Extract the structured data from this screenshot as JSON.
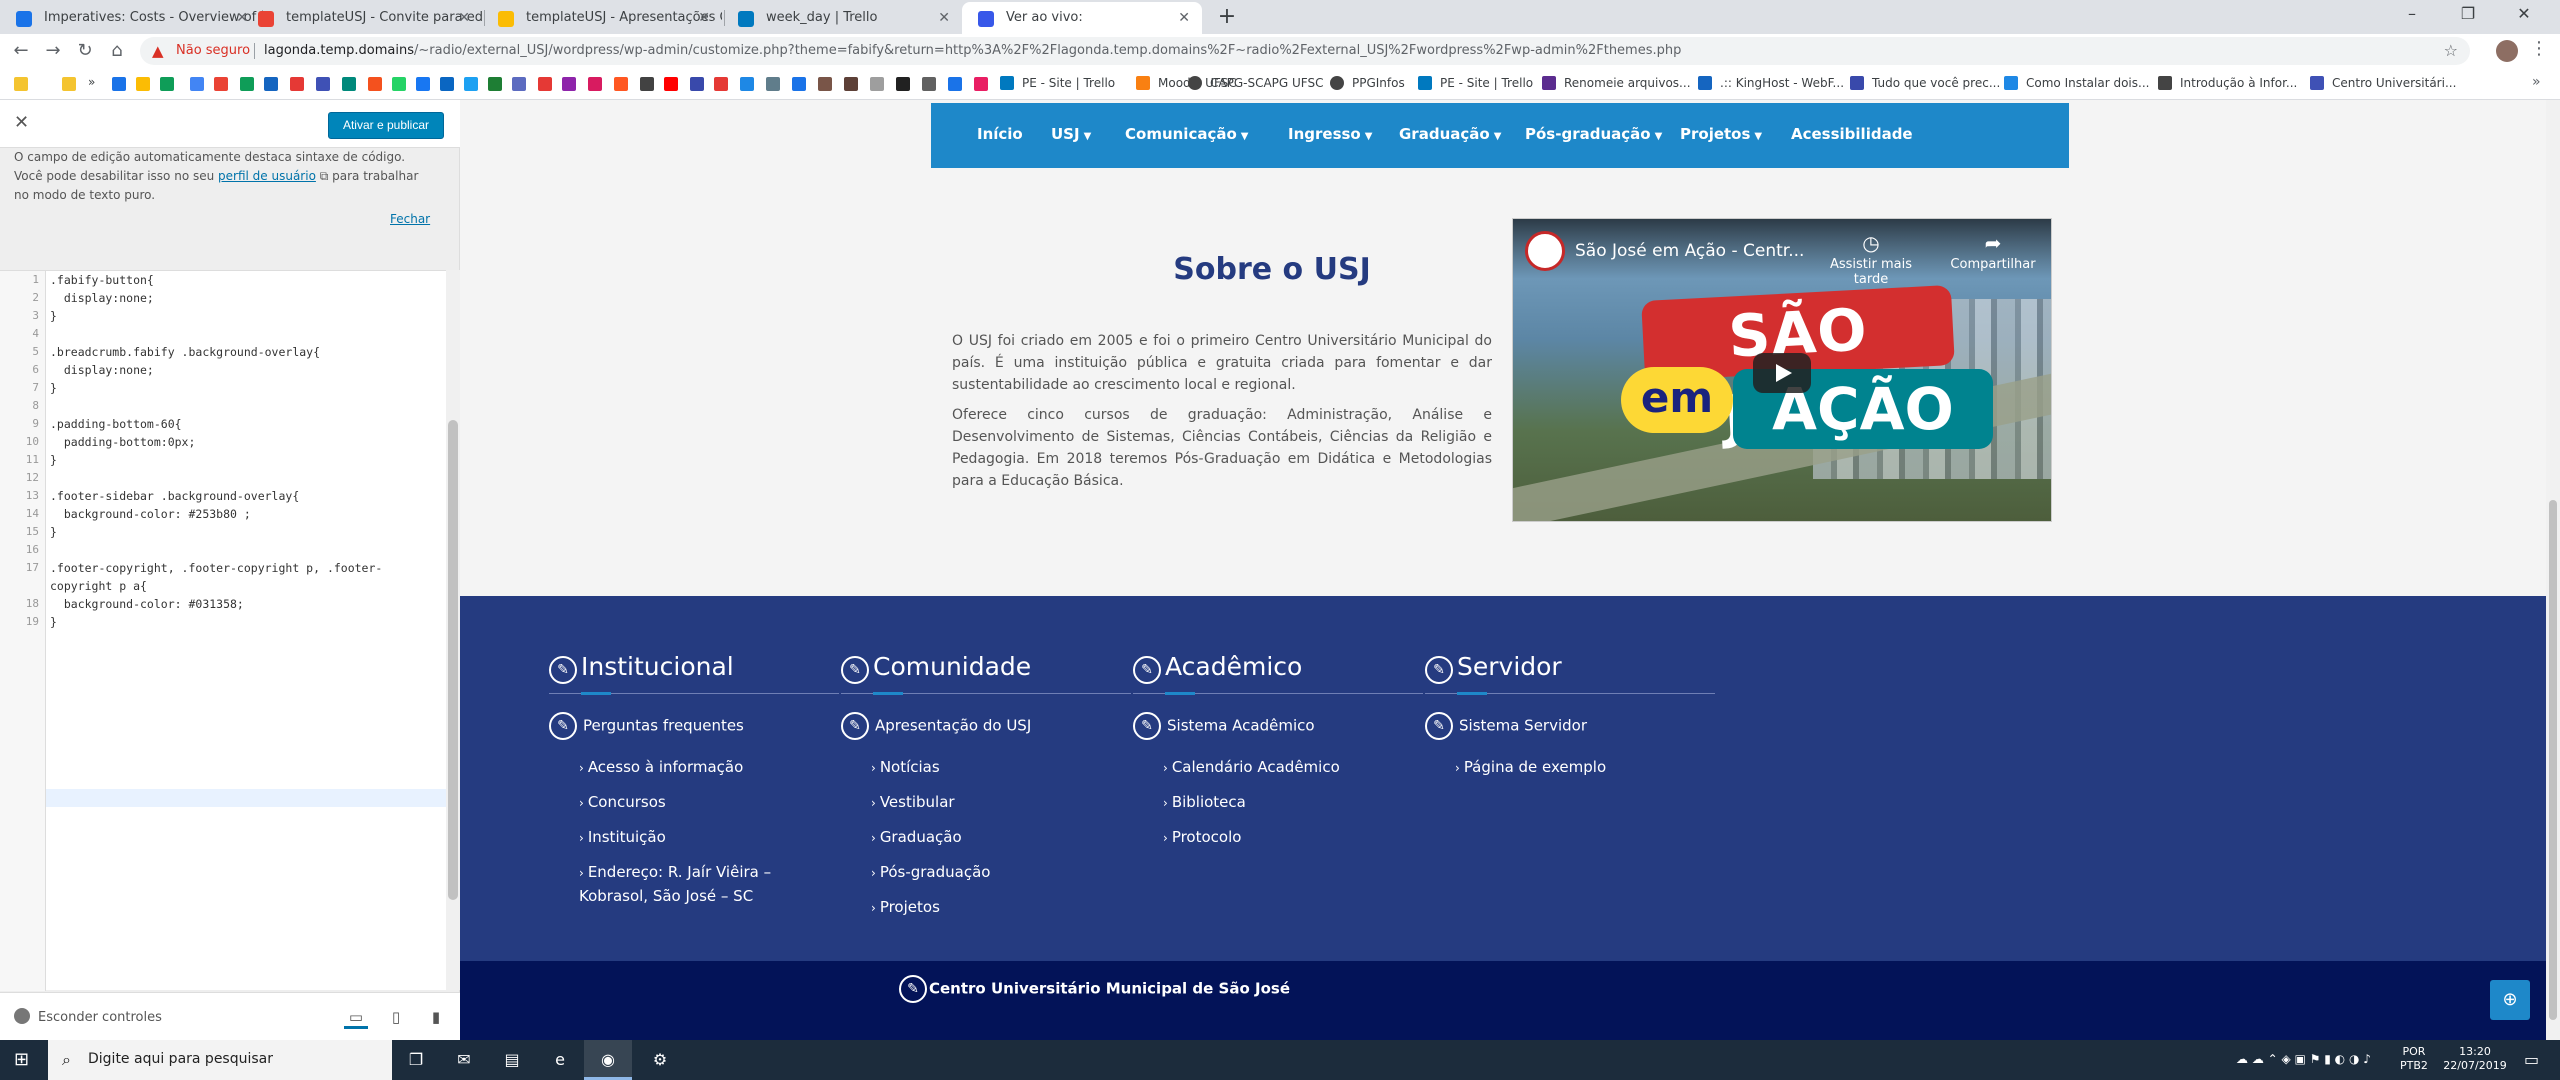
{
  "browser": {
    "tabs": [
      {
        "title": "Imperatives: Costs - Overview of",
        "color": "#1a73e8"
      },
      {
        "title": "templateUSJ - Convite para edita",
        "color": "#ea4335"
      },
      {
        "title": "templateUSJ - Apresentações Go",
        "color": "#fbbc04"
      },
      {
        "title": "week_day | Trello",
        "color": "#0079bf"
      },
      {
        "title": "Ver ao vivo:",
        "color": "#3858e9"
      }
    ],
    "new_tab": "+",
    "window_controls": [
      "–",
      "❐",
      "✕"
    ],
    "insecure_label": "Não seguro",
    "url_host": "lagonda.temp.domains",
    "url_path": "/~radio/external_USJ/wordpress/wp-admin/customize.php?theme=fabify&return=http%3A%2F%2Flagonda.temp.domains%2F~radio%2Fexternal_USJ%2Fwordpress%2Fwp-admin%2Fthemes.php",
    "bookmarks_more": "»",
    "bookmarks": [
      {
        "label": "PE - Site | Trello",
        "color": "#0079bf"
      },
      {
        "label": "Moodle UFSC",
        "color": "#f98012"
      },
      {
        "label": "CAPG-SCAPG UFSC",
        "color": "#444"
      },
      {
        "label": "PPGInfos",
        "color": "#444"
      },
      {
        "label": "PE - Site | Trello",
        "color": "#0079bf"
      },
      {
        "label": "Renomeie arquivos...",
        "color": "#5b2c8f"
      },
      {
        "label": ".:: KingHost - WebF...",
        "color": "#1565c0"
      },
      {
        "label": "Tudo que você prec...",
        "color": "#3949ab"
      },
      {
        "label": "Como Instalar dois...",
        "color": "#1e88e5"
      },
      {
        "label": "Introdução à Infor...",
        "color": "#444"
      },
      {
        "label": "Centro Universitári...",
        "color": "#3f51b5"
      }
    ]
  },
  "customizer": {
    "close": "✕",
    "publish_label": "Ativar e publicar",
    "notice_pre": "O campo de edição automaticamente destaca sintaxe de código. Você pode desabilitar isso no seu ",
    "notice_link": "perfil de usuário",
    "notice_post": " para trabalhar no modo de texto puro.",
    "close_notice": "Fechar",
    "code_lines": [
      ".fabify-button{",
      "  display:none;",
      "}",
      "",
      ".breadcrumb.fabify .background-overlay{",
      "  display:none;",
      "}",
      "",
      ".padding-bottom-60{",
      "  padding-bottom:0px;",
      "}",
      "",
      ".footer-sidebar .background-overlay{",
      "  background-color: #253b80 ;",
      "}",
      "",
      ".footer-copyright, .footer-copyright p, .footer-",
      "copyright p a{",
      "  background-color: #031358;",
      "}"
    ],
    "line_numbers": [
      "1",
      "2",
      "3",
      "4",
      "5",
      "6",
      "7",
      "8",
      "9",
      "10",
      "11",
      "12",
      "13",
      "14",
      "15",
      "16",
      "17",
      "",
      "18",
      "19"
    ],
    "hide_controls": "Esconder controles"
  },
  "site": {
    "nav": [
      {
        "label": "Início",
        "caret": false
      },
      {
        "label": "USJ",
        "caret": true
      },
      {
        "label": "Comunicação",
        "caret": true
      },
      {
        "label": "Ingresso",
        "caret": true
      },
      {
        "label": "Graduação",
        "caret": true
      },
      {
        "label": "Pós-graduação",
        "caret": true
      },
      {
        "label": "Projetos",
        "caret": true
      },
      {
        "label": "Acessibilidade",
        "caret": false
      }
    ],
    "about_title": "Sobre o USJ",
    "about_p1": "O USJ foi criado em 2005 e foi o primeiro Centro Universitário Municipal do país. É uma instituição pública e gratuita criada para fomentar e dar sustentabilidade ao crescimento local e regional.",
    "about_p2": "Oferece cinco cursos de graduação: Administração, Análise e Desenvolvimento de Sistemas, Ciências Contábeis, Ciências da Religião e Pedagogia. Em 2018 teremos Pós-Graduação em Didática e Metodologias para a Educação Básica.",
    "video": {
      "title": "São José em Ação - Centr...",
      "watch_later": "Assistir mais tarde",
      "share": "Compartilhar",
      "logo_line1": "SÃO JOSÉ",
      "logo_em": "em",
      "logo_line2": "AÇÃO"
    },
    "footer_columns": [
      {
        "title": "Institucional",
        "first": "Perguntas frequentes",
        "links": [
          "Acesso à informação",
          "Concursos",
          "Instituição",
          "Endereço: R. Jaír Viêira – Kobrasol, São José – SC"
        ]
      },
      {
        "title": "Comunidade",
        "first": "Apresentação do USJ",
        "links": [
          "Notícias",
          "Vestibular",
          "Graduação",
          "Pós-graduação",
          "Projetos"
        ]
      },
      {
        "title": "Acadêmico",
        "first": "Sistema Acadêmico",
        "links": [
          "Calendário Acadêmico",
          "Biblioteca",
          "Protocolo"
        ]
      },
      {
        "title": "Servidor",
        "first": "Sistema Servidor",
        "links": [
          "Página de exemplo"
        ]
      }
    ],
    "footer_bottom": "Centro Universitário Municipal de São José"
  },
  "taskbar": {
    "search_placeholder": "Digite aqui para pesquisar",
    "lang_line1": "POR",
    "lang_line2": "PTB2",
    "time": "13:20",
    "date": "22/07/2019"
  }
}
